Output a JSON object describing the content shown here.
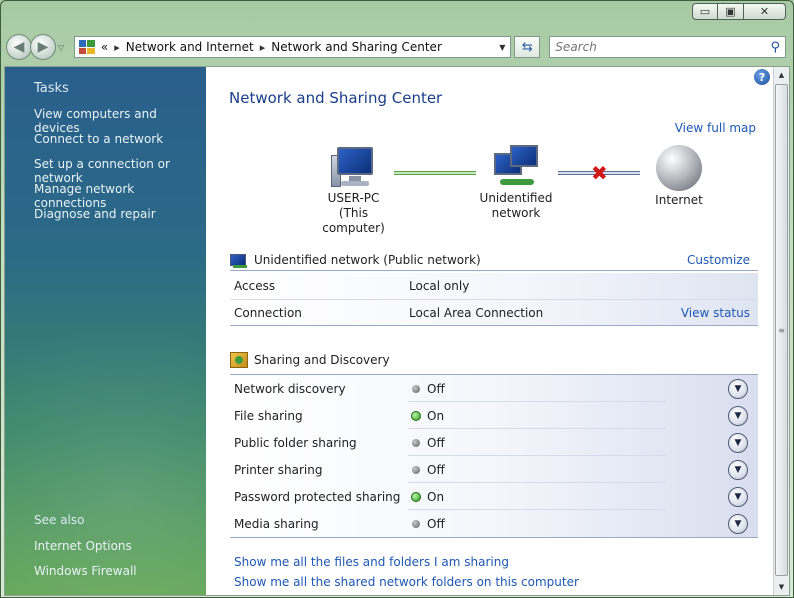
{
  "window": {
    "caption": {
      "minimize": "▭",
      "maximize": "▣",
      "close": "✕"
    }
  },
  "navigation": {
    "back_glyph": "◀",
    "forward_glyph": "▶",
    "breadcrumb_overflow": "«",
    "breadcrumbs": [
      "Network and Internet",
      "Network and Sharing Center"
    ],
    "separator": "▸",
    "search_placeholder": "Search"
  },
  "sidebar": {
    "tasks_title": "Tasks",
    "tasks": [
      "View computers and devices",
      "Connect to a network",
      "Set up a connection or network",
      "Manage network connections",
      "Diagnose and repair"
    ],
    "see_also_title": "See also",
    "see_also": [
      "Internet Options",
      "Windows Firewall"
    ]
  },
  "main": {
    "help_glyph": "?",
    "title": "Network and Sharing Center",
    "view_full_map": "View full map",
    "map": {
      "computer_name": "USER-PC",
      "computer_sub": "(This computer)",
      "network": "Unidentified network",
      "internet": "Internet",
      "disconnected_mark": "✖"
    },
    "network_section": {
      "title": "Unidentified network (Public network)",
      "customize": "Customize",
      "rows": [
        {
          "label": "Access",
          "value": "Local only"
        },
        {
          "label": "Connection",
          "value": "Local Area Connection",
          "action": "View status"
        }
      ]
    },
    "sharing_section": {
      "title": "Sharing and Discovery",
      "rows": [
        {
          "label": "Network discovery",
          "status": "Off"
        },
        {
          "label": "File sharing",
          "status": "On"
        },
        {
          "label": "Public folder sharing",
          "status": "Off"
        },
        {
          "label": "Printer sharing",
          "status": "Off"
        },
        {
          "label": "Password protected sharing",
          "status": "On"
        },
        {
          "label": "Media sharing",
          "status": "Off"
        }
      ]
    },
    "bottom_links": [
      "Show me all the files and folders I am sharing",
      "Show me all the shared network folders on this computer"
    ]
  },
  "colors": {
    "status_on": "#2f9a1e",
    "status_off": "#5e5e5e",
    "link": "#1e57b4",
    "title": "#1a3f8a"
  }
}
